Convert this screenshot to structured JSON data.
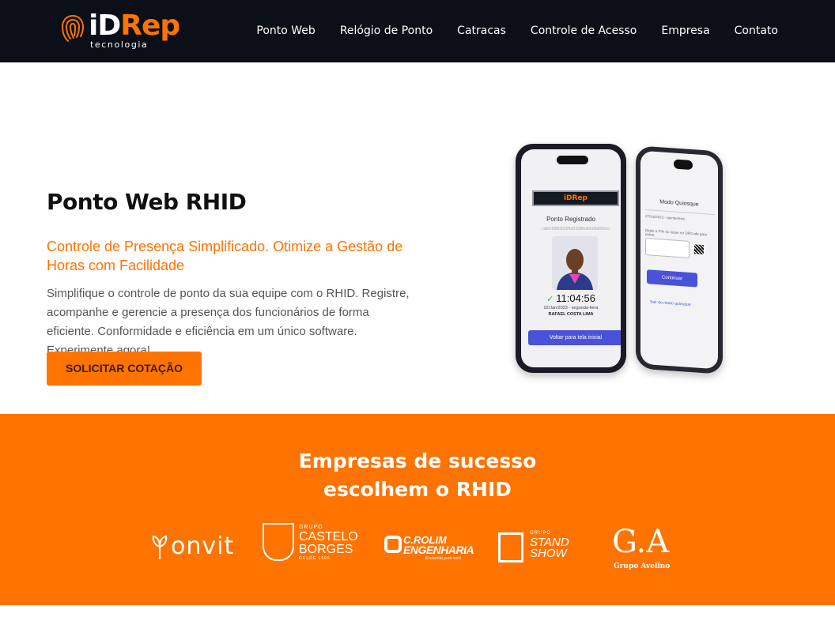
{
  "header": {
    "logo_main_1": "iD",
    "logo_main_2": "Rep",
    "logo_sub": "tecnologia",
    "nav": [
      "Ponto Web",
      "Relógio de Ponto",
      "Catracas",
      "Controle de Acesso",
      "Empresa",
      "Contato"
    ]
  },
  "hero": {
    "title": "Ponto Web RHID",
    "subtitle": "Controle de Presença Simplificado. Otimize a Gestão de Horas com Facilidade",
    "description": "Simplifique o controle de ponto da sua equipe com o RHID. Registre, acompanhe e gerencie a presença dos funcionários de forma eficiente. Conformidade e eficiência em um único software. Experimente agora!",
    "cta_label": "SOLICITAR COTAÇÃO"
  },
  "phone_main": {
    "logo": "iDRep",
    "title": "Ponto Registrado",
    "hash": "cdbf169f93b62ffaf1928fedb9d6d650cd",
    "time": "11:04:56",
    "date": "02/Jan/2023 - segunda-feira",
    "name": "RAFAEL COSTA LIMA",
    "button": "Voltar para tela inicial"
  },
  "phone_kiosk": {
    "title": "Modo Quiosque",
    "date": "27/Jul/2023 - quinta-feira",
    "hint": "Digite o PIN ou toque no QRCode para entrar",
    "input_placeholder": "PIN",
    "button": "Continuar",
    "exit": "Sair do modo quiosque"
  },
  "clients": {
    "title_line1": "Empresas de sucesso",
    "title_line2": "escolhem o RHID",
    "logos": {
      "onvit": "onvit",
      "castelo_group": "GRUPO",
      "castelo_1": "CASTELO",
      "castelo_2": "BORGES",
      "castelo_since": "DESDE 1995",
      "crolim_1": "C.ROLIM",
      "crolim_2": "ENGENHARIA",
      "crolim_tag": "Evoluindo para você",
      "stand_group": "GRUPO",
      "stand_1": "STAND",
      "stand_2": "SHOW",
      "ga_1": "G.A",
      "ga_2": "Grupo Avelino"
    }
  },
  "colors": {
    "accent": "#ff7300",
    "navbar": "#0b0f17",
    "button_blue": "#4a52d9"
  }
}
